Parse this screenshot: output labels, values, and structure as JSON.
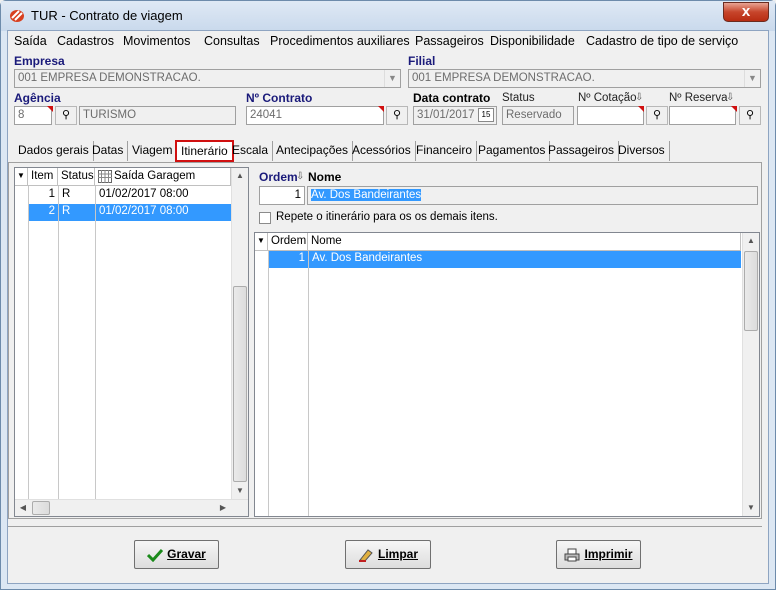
{
  "window": {
    "title": "TUR - Contrato de viagem",
    "close": "x"
  },
  "menu": [
    "Saída",
    "Cadastros",
    "Movimentos",
    "Consultas",
    "Procedimentos auxiliares",
    "Passageiros",
    "Disponibilidade",
    "Cadastro de tipo de serviço"
  ],
  "header": {
    "empresa_label": "Empresa",
    "empresa_value": "001 EMPRESA DEMONSTRACAO.",
    "filial_label": "Filial",
    "filial_value": "001 EMPRESA DEMONSTRACAO.",
    "agencia_label": "Agência",
    "agencia_code": "8",
    "agencia_name": "TURISMO",
    "contrato_label": "Nº Contrato",
    "contrato_value": "24041",
    "data_label": "Data contrato",
    "data_value": "31/01/2017",
    "cal_day": "15",
    "status_label": "Status",
    "status_value": "Reservado",
    "cotacao_label": "Nº Cotação",
    "reserva_label": "Nº Reserva"
  },
  "tabs": [
    "Dados gerais",
    "Datas",
    "Viagem",
    "Itinerário",
    "Escala",
    "Antecipações",
    "Acessórios",
    "Financeiro",
    "Pagamentos",
    "Passageiros",
    "Diversos"
  ],
  "left_grid": {
    "headers": [
      "Item",
      "Status",
      "Saída Garagem"
    ],
    "rows": [
      [
        "1",
        "R",
        "01/02/2017 08:00"
      ],
      [
        "2",
        "R",
        "01/02/2017 08:00"
      ]
    ]
  },
  "itinerary": {
    "ordem_label": "Ordem",
    "nome_label": "Nome",
    "ordem_value": "1",
    "nome_value": "Av. Dos Bandeirantes",
    "repeat_label": "Repete o itinerário para os os demais itens.",
    "grid_headers": [
      "Ordem",
      "Nome"
    ],
    "rows": [
      [
        "1",
        "Av. Dos Bandeirantes"
      ]
    ]
  },
  "buttons": {
    "save": "Gravar",
    "clear": "Limpar",
    "print": "Imprimir"
  },
  "colors": {
    "selection": "#3399ff",
    "label_blue": "#1a1a7a",
    "active_tab_border": "#d01010"
  }
}
